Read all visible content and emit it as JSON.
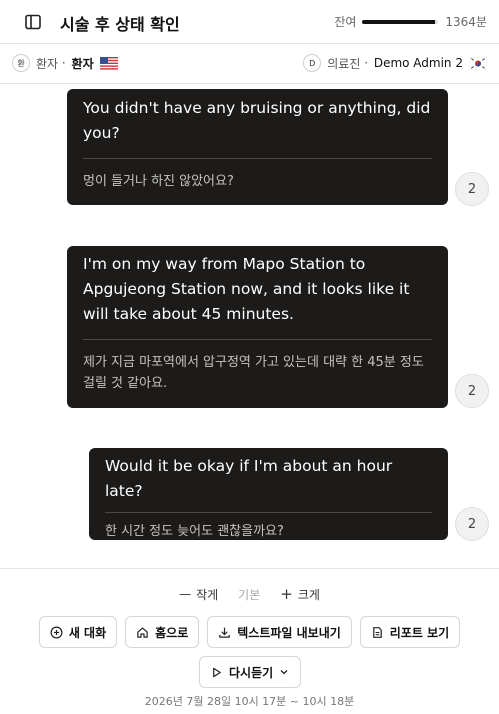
{
  "header": {
    "title": "시술 후 상태 확인",
    "remaining_label": "잔여",
    "remaining_value": "1364분",
    "remaining_fraction": 0.96
  },
  "participants": {
    "patient": {
      "avatar": "환",
      "role": "환자",
      "name": "환자",
      "flag": "us"
    },
    "provider": {
      "avatar": "D",
      "role": "의료진",
      "name": "Demo Admin 2",
      "flag": "kr"
    }
  },
  "messages": [
    {
      "source": "You didn't have any bruising or anything, did you?",
      "translation": "멍이 들거나 하진 않았어요?",
      "count": "2"
    },
    {
      "source": "I'm on my way from Mapo Station to Apgujeong Station now, and it looks like it will take about 45 minutes.",
      "translation": "제가 지금 마포역에서 압구정역 가고 있는데 대략 한 45분 정도 걸릴 것 같아요.",
      "count": "2"
    },
    {
      "source": "Would it be okay if I'm about an hour late?",
      "translation": "한 시간 정도 늦어도 괜찮을까요?",
      "count": "2"
    }
  ],
  "footer": {
    "size_small": "작게",
    "size_default": "기본",
    "size_large": "크게",
    "new_chat": "새 대화",
    "home": "홈으로",
    "export": "텍스트파일 내보내기",
    "report": "리포트 보기",
    "replay": "다시듣기",
    "timestamp": "2026년 7월 28일 10시 17분 ~ 10시 18분"
  }
}
